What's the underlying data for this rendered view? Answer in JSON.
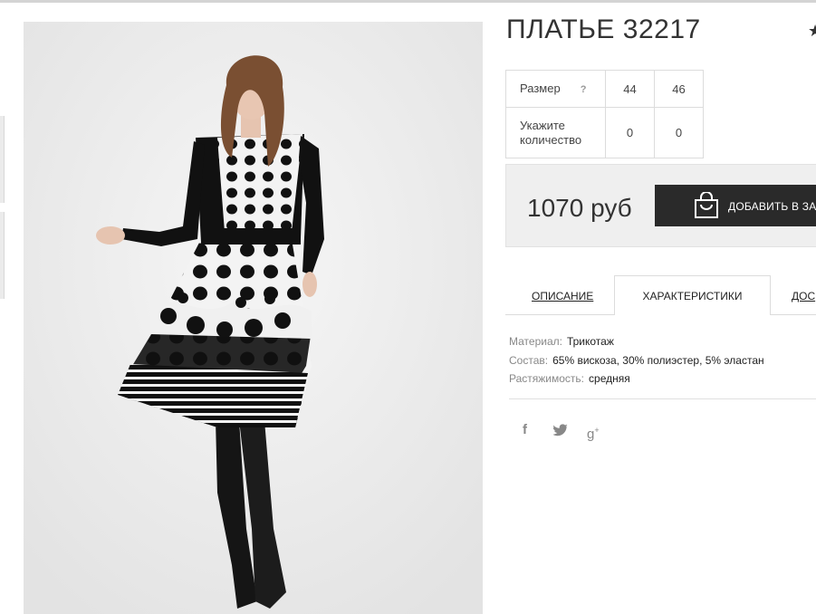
{
  "product": {
    "title": "ПЛАТЬЕ 32217",
    "star": "★"
  },
  "sizes_table": {
    "size_label": "Размер",
    "help_mark": "?",
    "sizes": [
      "44",
      "46"
    ],
    "qty_label": "Укажите количество",
    "quantities": [
      "0",
      "0"
    ]
  },
  "price": {
    "value": "1070 руб",
    "cart_button": "ДОБАВИТЬ В ЗА"
  },
  "tabs": {
    "description": "ОПИСАНИЕ",
    "characteristics": "ХАРАКТЕРИСТИКИ",
    "delivery": "ДОС"
  },
  "specs": [
    {
      "label": "Материал:",
      "value": "Трикотаж"
    },
    {
      "label": "Состав:",
      "value": "65% вискоза, 30% полиэстер, 5% эластан"
    },
    {
      "label": "Растяжимость:",
      "value": "средняя"
    }
  ],
  "social": {
    "facebook": "f",
    "googleplus": "g",
    "googleplus_sup": "+"
  },
  "colors": {
    "accent_dark": "#2a2a2a",
    "price_bg": "#efefef",
    "photo_bg": "#ececec"
  }
}
